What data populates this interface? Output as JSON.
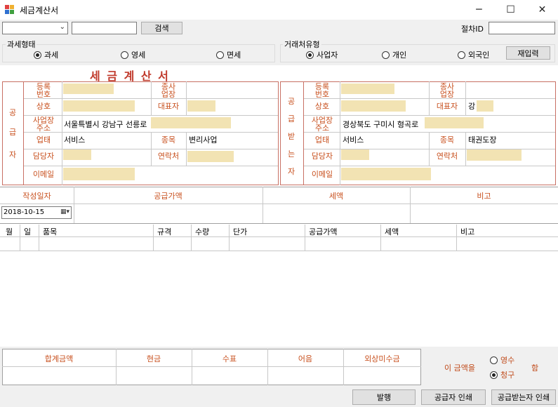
{
  "window": {
    "title": "세금계산서",
    "minimize": "─",
    "maximize": "☐",
    "close": "✕"
  },
  "toolbar": {
    "search_label": "검색",
    "process_id_label": "절차ID",
    "dropdown_value": "",
    "search_value": "",
    "process_id_value": ""
  },
  "tax_type": {
    "label": "과세형태",
    "options": [
      "과세",
      "영세",
      "면세"
    ],
    "selected": 0
  },
  "partner_type": {
    "label": "거래처유형",
    "options": [
      "사업자",
      "개인",
      "외국인"
    ],
    "selected": 0,
    "reset_label": "재입력"
  },
  "invoice": {
    "title": "세 금 계 산 서",
    "supplier": {
      "side_label": [
        "공",
        "급",
        "자"
      ],
      "reg_no_label": "등록\n번호",
      "sub_branch_label": "종사\n업장",
      "name_label": "상호",
      "rep_label": "대표자",
      "address_label": "사업장\n주소",
      "address_value": "서울특별시 강남구 선릉로",
      "biz_type_label": "업태",
      "biz_type_value": "서비스",
      "item_label": "종목",
      "item_value": "변리사업",
      "manager_label": "담당자",
      "contact_label": "연락처",
      "email_label": "이메일"
    },
    "receiver": {
      "side_label": [
        "공",
        "급",
        "받",
        "는",
        "자"
      ],
      "reg_no_label": "등록\n번호",
      "sub_branch_label": "종사\n업장",
      "name_label": "상호",
      "rep_label": "대표자",
      "rep_value": "강",
      "address_label": "사업장\n주소",
      "address_value": "경상북도 구미시 형곡로",
      "biz_type_label": "업태",
      "biz_type_value": "서비스",
      "item_label": "종목",
      "item_value": "태권도장",
      "manager_label": "담당자",
      "contact_label": "연락처",
      "email_label": "이메일"
    }
  },
  "summary": {
    "date_label": "작성일자",
    "supply_label": "공급가액",
    "tax_label": "세액",
    "note_label": "비고",
    "date_value": "2018-10-15"
  },
  "items_table": {
    "columns": [
      "월",
      "일",
      "품목",
      "규격",
      "수량",
      "단가",
      "공급가액",
      "세액",
      "비고"
    ]
  },
  "totals": {
    "columns": [
      "합계금액",
      "현금",
      "수표",
      "어음",
      "외상미수금"
    ],
    "this_amount_label": "이 금액을",
    "receipt_label": "영수",
    "claim_label": "청구",
    "selected": "청구",
    "suffix": "함"
  },
  "actions": {
    "issue": "발행",
    "print_supplier": "공급자 인쇄",
    "print_receiver": "공급받는자 인쇄"
  }
}
